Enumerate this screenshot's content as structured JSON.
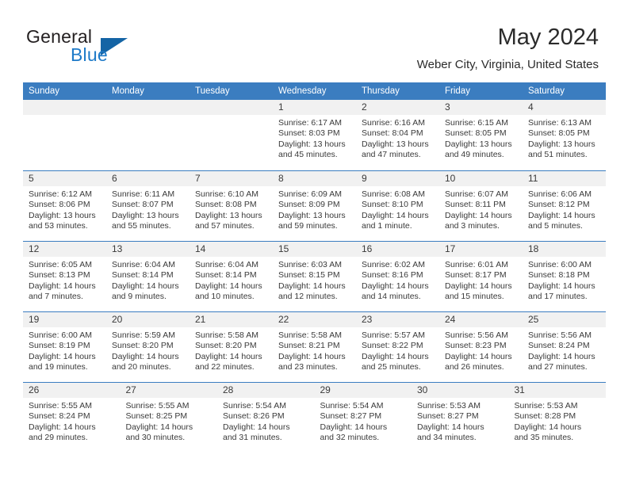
{
  "brand": {
    "name_top": "General",
    "name_bottom": "Blue",
    "triangle_color": "#1464a5",
    "blue_color": "#1e7ac8"
  },
  "header": {
    "title": "May 2024",
    "subtitle": "Weber City, Virginia, United States"
  },
  "theme": {
    "header_blue": "#3b7dc0",
    "daynum_band": "#f1f1f1",
    "text": "#3a3a3a"
  },
  "weekday_headers": [
    "Sunday",
    "Monday",
    "Tuesday",
    "Wednesday",
    "Thursday",
    "Friday",
    "Saturday"
  ],
  "weeks": [
    [
      {
        "day": "",
        "empty": true,
        "sunrise": "",
        "sunset": "",
        "daylight_1": "",
        "daylight_2": ""
      },
      {
        "day": "",
        "empty": true,
        "sunrise": "",
        "sunset": "",
        "daylight_1": "",
        "daylight_2": ""
      },
      {
        "day": "",
        "empty": true,
        "sunrise": "",
        "sunset": "",
        "daylight_1": "",
        "daylight_2": ""
      },
      {
        "day": "1",
        "sunrise": "Sunrise: 6:17 AM",
        "sunset": "Sunset: 8:03 PM",
        "daylight_1": "Daylight: 13 hours",
        "daylight_2": "and 45 minutes."
      },
      {
        "day": "2",
        "sunrise": "Sunrise: 6:16 AM",
        "sunset": "Sunset: 8:04 PM",
        "daylight_1": "Daylight: 13 hours",
        "daylight_2": "and 47 minutes."
      },
      {
        "day": "3",
        "sunrise": "Sunrise: 6:15 AM",
        "sunset": "Sunset: 8:05 PM",
        "daylight_1": "Daylight: 13 hours",
        "daylight_2": "and 49 minutes."
      },
      {
        "day": "4",
        "sunrise": "Sunrise: 6:13 AM",
        "sunset": "Sunset: 8:05 PM",
        "daylight_1": "Daylight: 13 hours",
        "daylight_2": "and 51 minutes."
      }
    ],
    [
      {
        "day": "5",
        "sunrise": "Sunrise: 6:12 AM",
        "sunset": "Sunset: 8:06 PM",
        "daylight_1": "Daylight: 13 hours",
        "daylight_2": "and 53 minutes."
      },
      {
        "day": "6",
        "sunrise": "Sunrise: 6:11 AM",
        "sunset": "Sunset: 8:07 PM",
        "daylight_1": "Daylight: 13 hours",
        "daylight_2": "and 55 minutes."
      },
      {
        "day": "7",
        "sunrise": "Sunrise: 6:10 AM",
        "sunset": "Sunset: 8:08 PM",
        "daylight_1": "Daylight: 13 hours",
        "daylight_2": "and 57 minutes."
      },
      {
        "day": "8",
        "sunrise": "Sunrise: 6:09 AM",
        "sunset": "Sunset: 8:09 PM",
        "daylight_1": "Daylight: 13 hours",
        "daylight_2": "and 59 minutes."
      },
      {
        "day": "9",
        "sunrise": "Sunrise: 6:08 AM",
        "sunset": "Sunset: 8:10 PM",
        "daylight_1": "Daylight: 14 hours",
        "daylight_2": "and 1 minute."
      },
      {
        "day": "10",
        "sunrise": "Sunrise: 6:07 AM",
        "sunset": "Sunset: 8:11 PM",
        "daylight_1": "Daylight: 14 hours",
        "daylight_2": "and 3 minutes."
      },
      {
        "day": "11",
        "sunrise": "Sunrise: 6:06 AM",
        "sunset": "Sunset: 8:12 PM",
        "daylight_1": "Daylight: 14 hours",
        "daylight_2": "and 5 minutes."
      }
    ],
    [
      {
        "day": "12",
        "sunrise": "Sunrise: 6:05 AM",
        "sunset": "Sunset: 8:13 PM",
        "daylight_1": "Daylight: 14 hours",
        "daylight_2": "and 7 minutes."
      },
      {
        "day": "13",
        "sunrise": "Sunrise: 6:04 AM",
        "sunset": "Sunset: 8:14 PM",
        "daylight_1": "Daylight: 14 hours",
        "daylight_2": "and 9 minutes."
      },
      {
        "day": "14",
        "sunrise": "Sunrise: 6:04 AM",
        "sunset": "Sunset: 8:14 PM",
        "daylight_1": "Daylight: 14 hours",
        "daylight_2": "and 10 minutes."
      },
      {
        "day": "15",
        "sunrise": "Sunrise: 6:03 AM",
        "sunset": "Sunset: 8:15 PM",
        "daylight_1": "Daylight: 14 hours",
        "daylight_2": "and 12 minutes."
      },
      {
        "day": "16",
        "sunrise": "Sunrise: 6:02 AM",
        "sunset": "Sunset: 8:16 PM",
        "daylight_1": "Daylight: 14 hours",
        "daylight_2": "and 14 minutes."
      },
      {
        "day": "17",
        "sunrise": "Sunrise: 6:01 AM",
        "sunset": "Sunset: 8:17 PM",
        "daylight_1": "Daylight: 14 hours",
        "daylight_2": "and 15 minutes."
      },
      {
        "day": "18",
        "sunrise": "Sunrise: 6:00 AM",
        "sunset": "Sunset: 8:18 PM",
        "daylight_1": "Daylight: 14 hours",
        "daylight_2": "and 17 minutes."
      }
    ],
    [
      {
        "day": "19",
        "sunrise": "Sunrise: 6:00 AM",
        "sunset": "Sunset: 8:19 PM",
        "daylight_1": "Daylight: 14 hours",
        "daylight_2": "and 19 minutes."
      },
      {
        "day": "20",
        "sunrise": "Sunrise: 5:59 AM",
        "sunset": "Sunset: 8:20 PM",
        "daylight_1": "Daylight: 14 hours",
        "daylight_2": "and 20 minutes."
      },
      {
        "day": "21",
        "sunrise": "Sunrise: 5:58 AM",
        "sunset": "Sunset: 8:20 PM",
        "daylight_1": "Daylight: 14 hours",
        "daylight_2": "and 22 minutes."
      },
      {
        "day": "22",
        "sunrise": "Sunrise: 5:58 AM",
        "sunset": "Sunset: 8:21 PM",
        "daylight_1": "Daylight: 14 hours",
        "daylight_2": "and 23 minutes."
      },
      {
        "day": "23",
        "sunrise": "Sunrise: 5:57 AM",
        "sunset": "Sunset: 8:22 PM",
        "daylight_1": "Daylight: 14 hours",
        "daylight_2": "and 25 minutes."
      },
      {
        "day": "24",
        "sunrise": "Sunrise: 5:56 AM",
        "sunset": "Sunset: 8:23 PM",
        "daylight_1": "Daylight: 14 hours",
        "daylight_2": "and 26 minutes."
      },
      {
        "day": "25",
        "sunrise": "Sunrise: 5:56 AM",
        "sunset": "Sunset: 8:24 PM",
        "daylight_1": "Daylight: 14 hours",
        "daylight_2": "and 27 minutes."
      }
    ],
    [
      {
        "day": "26",
        "sunrise": "Sunrise: 5:55 AM",
        "sunset": "Sunset: 8:24 PM",
        "daylight_1": "Daylight: 14 hours",
        "daylight_2": "and 29 minutes."
      },
      {
        "day": "27",
        "sunrise": "Sunrise: 5:55 AM",
        "sunset": "Sunset: 8:25 PM",
        "daylight_1": "Daylight: 14 hours",
        "daylight_2": "and 30 minutes."
      },
      {
        "day": "28",
        "sunrise": "Sunrise: 5:54 AM",
        "sunset": "Sunset: 8:26 PM",
        "daylight_1": "Daylight: 14 hours",
        "daylight_2": "and 31 minutes."
      },
      {
        "day": "29",
        "sunrise": "Sunrise: 5:54 AM",
        "sunset": "Sunset: 8:27 PM",
        "daylight_1": "Daylight: 14 hours",
        "daylight_2": "and 32 minutes."
      },
      {
        "day": "30",
        "sunrise": "Sunrise: 5:53 AM",
        "sunset": "Sunset: 8:27 PM",
        "daylight_1": "Daylight: 14 hours",
        "daylight_2": "and 34 minutes."
      },
      {
        "day": "31",
        "sunrise": "Sunrise: 5:53 AM",
        "sunset": "Sunset: 8:28 PM",
        "daylight_1": "Daylight: 14 hours",
        "daylight_2": "and 35 minutes."
      }
    ]
  ]
}
